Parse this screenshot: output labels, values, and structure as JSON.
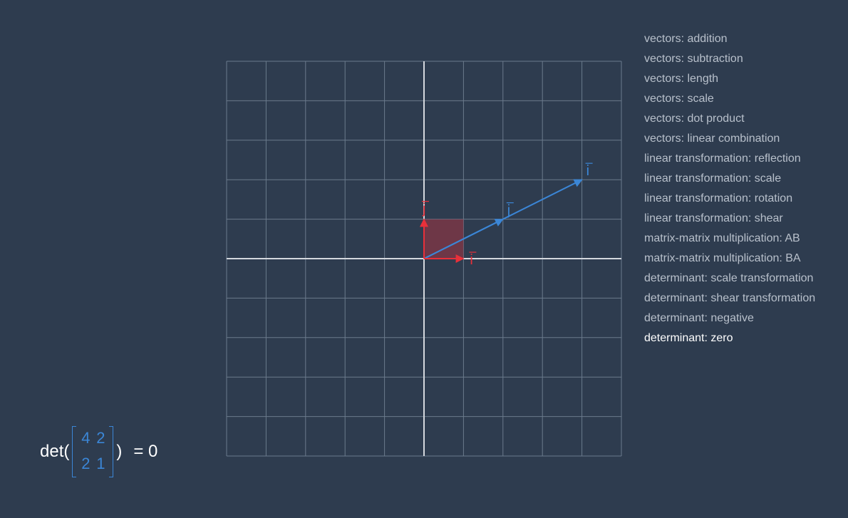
{
  "menu": {
    "items": [
      "vectors: addition",
      "vectors: subtraction",
      "vectors: length",
      "vectors: scale",
      "vectors: dot product",
      "vectors: linear combination",
      "linear transformation: reflection",
      "linear transformation: scale",
      "linear transformation: rotation",
      "linear transformation: shear",
      "matrix-matrix multiplication: AB",
      "matrix-matrix multiplication: BA",
      "determinant: scale transformation",
      "determinant: shear transformation",
      "determinant: negative",
      "determinant: zero"
    ],
    "active_index": 15
  },
  "determinant": {
    "prefix": "det(",
    "suffix": ")",
    "result": "= 0",
    "matrix": [
      [
        "4",
        "2"
      ],
      [
        "2",
        "1"
      ]
    ]
  },
  "plot": {
    "grid_range": [
      -5,
      5
    ],
    "basis": {
      "i": [
        1,
        0
      ],
      "j": [
        0,
        1
      ]
    },
    "transformed": {
      "i": [
        4,
        2
      ],
      "j": [
        2,
        1
      ]
    },
    "labels": {
      "i": "i",
      "j": "j"
    },
    "colors": {
      "background": "#2e3c4f",
      "grid": "#6b7a8c",
      "axis": "#d4d8de",
      "basis": "#e8303a",
      "transformed": "#3b86d6",
      "area_fill": "#8a3444"
    }
  }
}
